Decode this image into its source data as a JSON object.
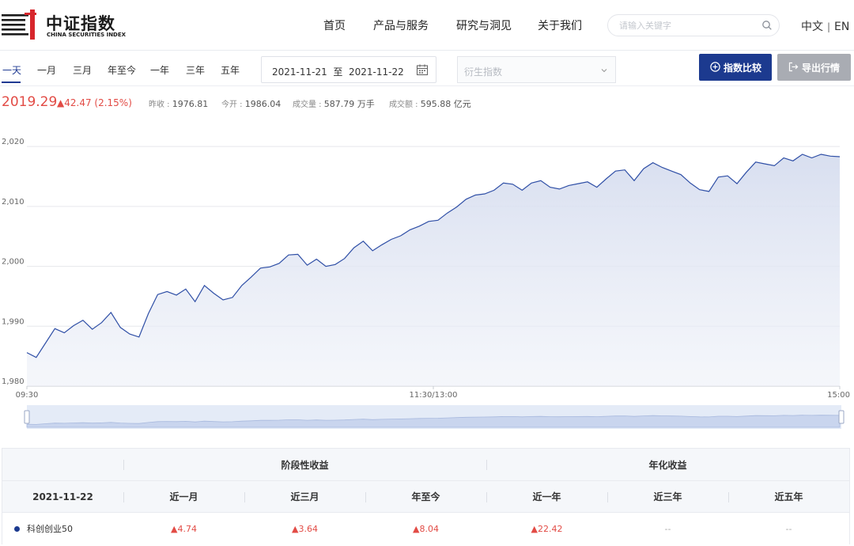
{
  "header": {
    "logo_cn": "中证指数",
    "logo_en": "CHINA SECURITIES INDEX",
    "nav": [
      "首页",
      "产品与服务",
      "研究与洞见",
      "关于我们"
    ],
    "search_placeholder": "请输入关键字",
    "lang_cn": "中文",
    "lang_sep": "|",
    "lang_en": "EN"
  },
  "toolbar": {
    "ranges": [
      "一天",
      "一月",
      "三月",
      "年至今",
      "一年",
      "三年",
      "五年"
    ],
    "active_range": "一天",
    "date_range": "2021-11-21  至  2021-11-22",
    "derivative_placeholder": "衍生指数",
    "compare_label": "指数比较",
    "export_label": "导出行情"
  },
  "quote": {
    "price": "2019.29",
    "change": "▲42.47 (2.15%)",
    "prev_close_label": "昨收 : ",
    "prev_close": "1976.81",
    "open_label": "今开 : ",
    "open": "1986.04",
    "volume_label": "成交量 : ",
    "volume": "587.79 万手",
    "turnover_label": "成交额 : ",
    "turnover": "595.88 亿元"
  },
  "chart_data": {
    "type": "area",
    "series": [
      {
        "name": "",
        "start_time": "09:30",
        "end_time": "15:00",
        "values": [
          1985.6,
          1984.8,
          1987.2,
          1989.6,
          1988.9,
          1990.1,
          1991.0,
          1989.5,
          1990.6,
          1992.3,
          1989.8,
          1988.7,
          1988.2,
          1992.1,
          1995.3,
          1995.8,
          1995.2,
          1996.2,
          1994.1,
          1996.8,
          1995.5,
          1994.4,
          1994.8,
          1996.8,
          1998.2,
          1999.7,
          1999.9,
          2000.5,
          2001.9,
          2002.0,
          2000.2,
          2001.2,
          2000.0,
          2000.3,
          2001.3,
          2003.1,
          2004.2,
          2002.6,
          2003.6,
          2004.5,
          2005.1,
          2006.1,
          2006.7,
          2007.5,
          2007.7,
          2008.9,
          2009.9,
          2011.2,
          2011.9,
          2012.1,
          2012.7,
          2013.9,
          2013.7,
          2012.7,
          2013.9,
          2014.3,
          2013.2,
          2012.9,
          2013.5,
          2013.8,
          2014.1,
          2013.2,
          2014.6,
          2015.9,
          2016.1,
          2014.3,
          2016.3,
          2017.3,
          2016.5,
          2015.9,
          2015.3,
          2013.9,
          2012.8,
          2012.5,
          2014.9,
          2015.1,
          2013.8,
          2015.7,
          2017.4,
          2017.1,
          2016.8,
          2018.1,
          2017.6,
          2018.7,
          2018.1,
          2018.7,
          2018.4,
          2018.3
        ]
      }
    ],
    "x_ticks": [
      "09:30",
      "11:30/13:00",
      "15:00"
    ],
    "y_ticks": [
      "1,980",
      "1,990",
      "2,000",
      "2,010",
      "2,020"
    ],
    "ylim": [
      1980,
      2022
    ],
    "colors": {
      "line": "#2f4fa6",
      "fill": "#dfe5f3"
    }
  },
  "performance": {
    "group_stage": "阶段性收益",
    "group_annual": "年化收益",
    "date": "2021-11-22",
    "columns": [
      "近一月",
      "近三月",
      "年至今",
      "近一年",
      "近三年",
      "近五年"
    ],
    "rows": [
      {
        "name": "科创创业50",
        "values": [
          "▲4.74",
          "▲3.64",
          "▲8.04",
          "▲22.42",
          "--",
          "--"
        ]
      }
    ]
  }
}
